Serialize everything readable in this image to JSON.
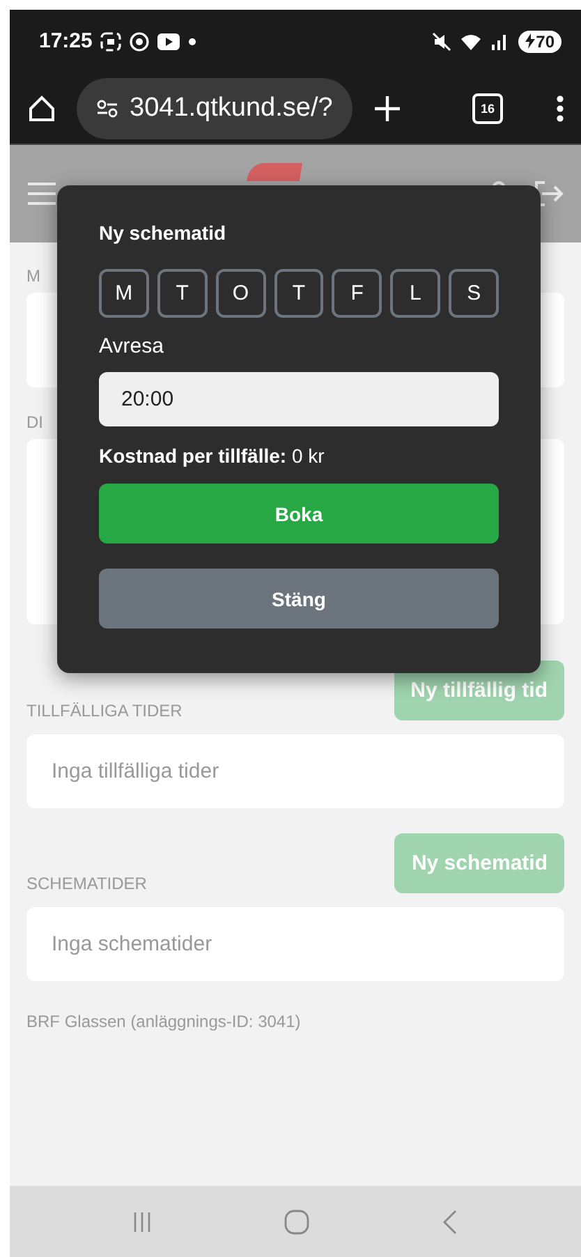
{
  "status_bar": {
    "time": "17:25",
    "battery": "70"
  },
  "browser": {
    "url": "3041.qtkund.se/?",
    "tab_count": "16"
  },
  "page": {
    "hidden_labels": [
      "M",
      "DI"
    ],
    "temporary": {
      "button": "Ny tillfällig tid",
      "heading": "TILLFÄLLIGA TIDER",
      "empty": "Inga tillfälliga tider"
    },
    "schedule": {
      "button": "Ny schematid",
      "heading": "SCHEMATIDER",
      "empty": "Inga schematider"
    },
    "footer": "BRF Glassen (anläggnings-ID: 3041)"
  },
  "dialog": {
    "title": "Ny schematid",
    "days": [
      {
        "label": "M",
        "selected": false
      },
      {
        "label": "T",
        "selected": false
      },
      {
        "label": "O",
        "selected": false
      },
      {
        "label": "T",
        "selected": false
      },
      {
        "label": "F",
        "selected": false
      },
      {
        "label": "L",
        "selected": false
      },
      {
        "label": "S",
        "selected": false
      }
    ],
    "departure_label": "Avresa",
    "departure_value": "20:00",
    "cost_label": "Kostnad per tillfälle:",
    "cost_value": "0 kr",
    "book_button": "Boka",
    "close_button": "Stäng"
  }
}
